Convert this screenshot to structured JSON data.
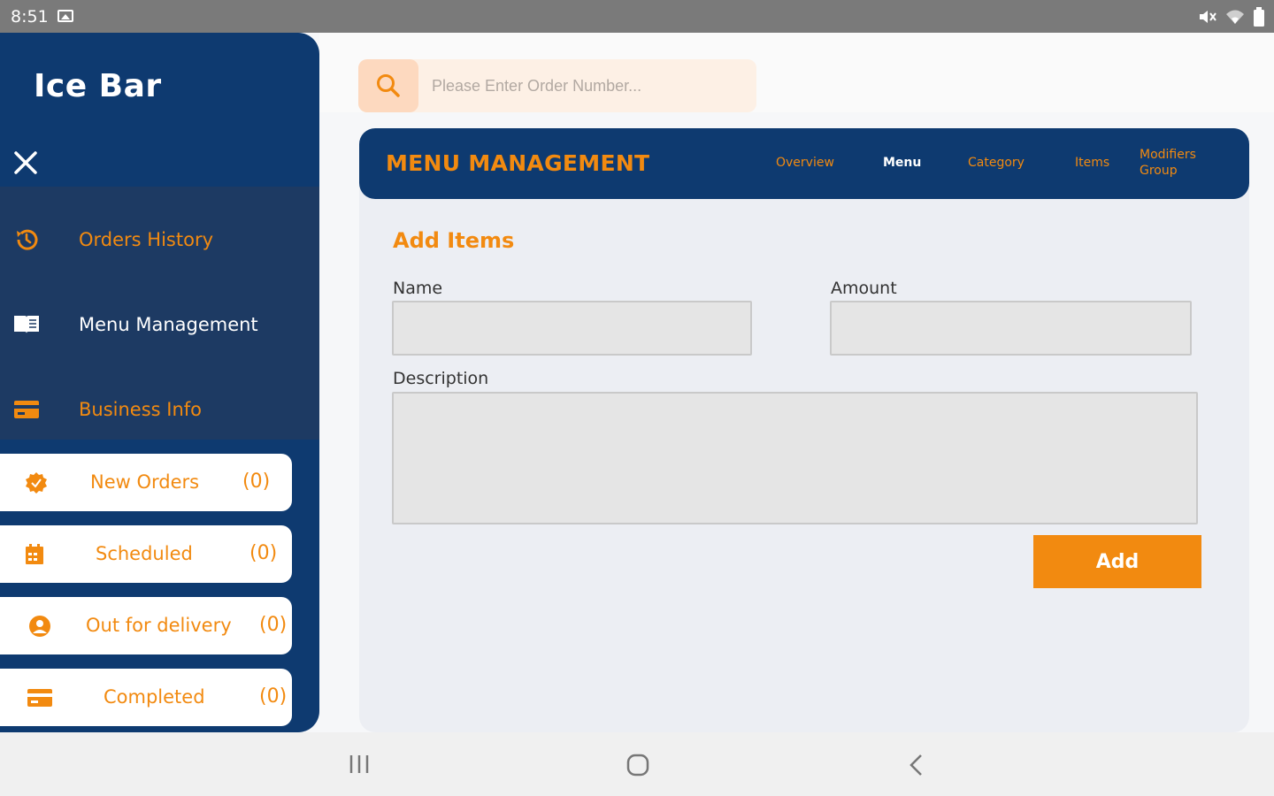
{
  "status_bar": {
    "time": "8:51",
    "icons": [
      "image-icon",
      "mute-icon",
      "wifi-icon",
      "battery-icon"
    ]
  },
  "sidebar": {
    "brand": "Ice Bar",
    "nav_items": [
      {
        "label": "Orders History",
        "icon": "history-icon"
      },
      {
        "label": "Menu Management",
        "icon": "book-icon"
      },
      {
        "label": "Business Info",
        "icon": "card-icon"
      }
    ],
    "status_cards": [
      {
        "label": "New Orders",
        "count": "(0)",
        "icon": "badge-check-icon"
      },
      {
        "label": "Scheduled",
        "count": "(0)",
        "icon": "calendar-icon"
      },
      {
        "label": "Out for delivery",
        "count": "(0)",
        "icon": "person-icon"
      },
      {
        "label": "Completed",
        "count": "(0)",
        "icon": "card-icon"
      }
    ]
  },
  "search": {
    "placeholder": "Please Enter Order Number..."
  },
  "header": {
    "title": "MENU MANAGEMENT",
    "tabs": [
      {
        "label": "Overview"
      },
      {
        "label": "Menu"
      },
      {
        "label": "Category"
      },
      {
        "label": "Items"
      },
      {
        "label": "Modifiers Group"
      }
    ]
  },
  "form": {
    "title": "Add Items",
    "name_label": "Name",
    "amount_label": "Amount",
    "description_label": "Description",
    "name_value": "",
    "amount_value": "",
    "description_value": "",
    "add_label": "Add"
  },
  "colors": {
    "navy": "#0e3a70",
    "nav_block": "#1d3a63",
    "accent": "#f28a10"
  }
}
